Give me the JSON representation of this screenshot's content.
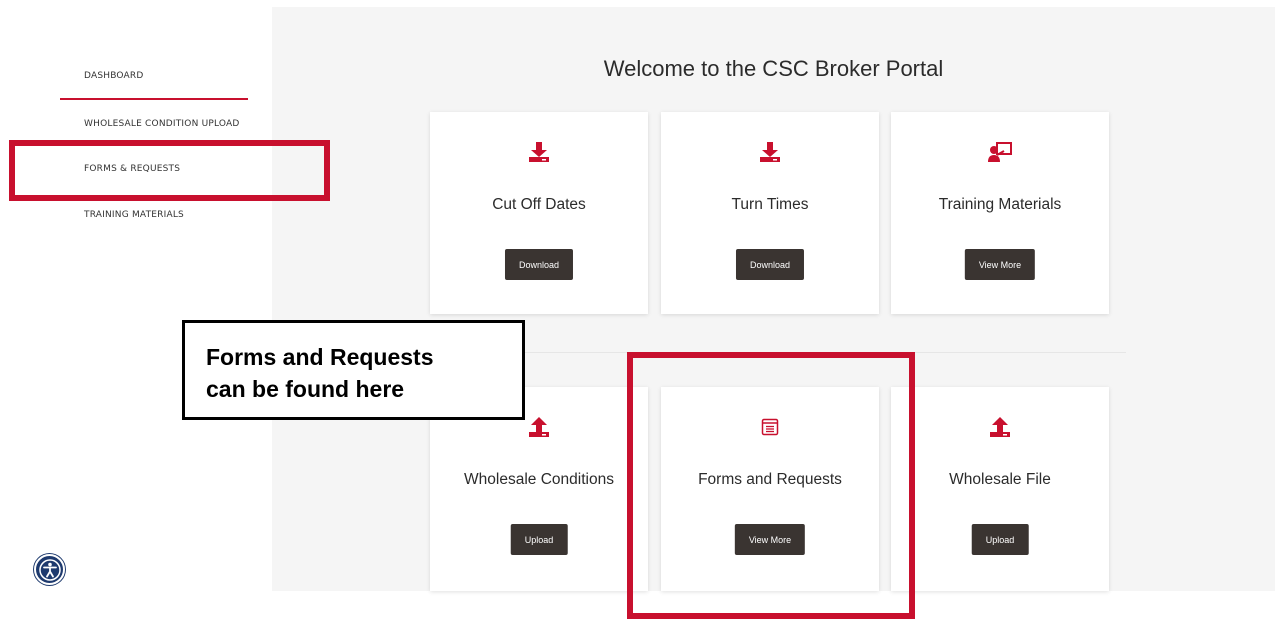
{
  "sidebar": {
    "items": [
      {
        "label": "DASHBOARD",
        "active": true
      },
      {
        "label": "WHOLESALE CONDITION UPLOAD"
      },
      {
        "label": "FORMS & REQUESTS"
      },
      {
        "label": "TRAINING MATERIALS"
      }
    ]
  },
  "main": {
    "title": "Welcome to the CSC Broker Portal",
    "cards": [
      {
        "title": "Cut Off Dates",
        "button": "Download",
        "icon": "download-icon"
      },
      {
        "title": "Turn Times",
        "button": "Download",
        "icon": "download-icon"
      },
      {
        "title": "Training Materials",
        "button": "View More",
        "icon": "presenter-icon"
      },
      {
        "title": "Wholesale Conditions",
        "button": "Upload",
        "icon": "upload-icon"
      },
      {
        "title": "Forms and Requests",
        "button": "View More",
        "icon": "form-icon"
      },
      {
        "title": "Wholesale File",
        "button": "Upload",
        "icon": "upload-icon"
      }
    ]
  },
  "callout": {
    "line1": "Forms and Requests",
    "line2": "can be found here"
  },
  "colors": {
    "accent": "#c8102e",
    "button": "#3a3431",
    "background": "#f5f5f5",
    "accessibility": "#1e3a6e"
  }
}
